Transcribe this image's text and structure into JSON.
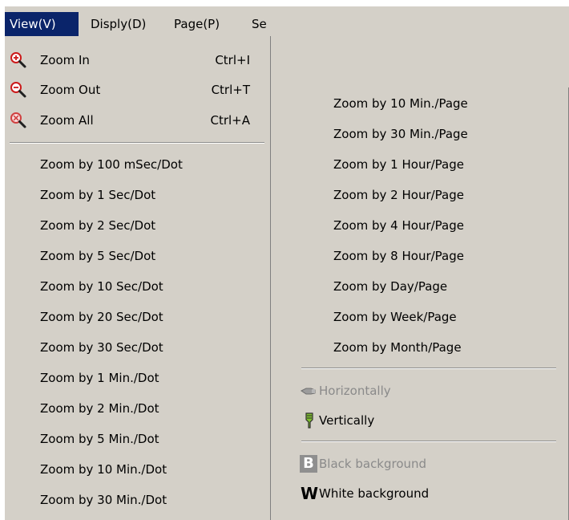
{
  "menubar": {
    "items": [
      {
        "label": "View(V)"
      },
      {
        "label": "Disply(D)"
      },
      {
        "label": "Page(P)"
      },
      {
        "label": "Se"
      }
    ]
  },
  "view_menu": {
    "items": [
      {
        "label": "Zoom In",
        "shortcut": "Ctrl+I",
        "icon": "zoom-in-icon"
      },
      {
        "label": "Zoom Out",
        "shortcut": "Ctrl+T",
        "icon": "zoom-out-icon"
      },
      {
        "label": "Zoom All",
        "shortcut": "Ctrl+A",
        "icon": "zoom-all-icon"
      },
      {
        "label": "Zoom by 100 mSec/Dot"
      },
      {
        "label": "Zoom by 1 Sec/Dot"
      },
      {
        "label": "Zoom by 2 Sec/Dot"
      },
      {
        "label": "Zoom by 5 Sec/Dot"
      },
      {
        "label": "Zoom by 10 Sec/Dot"
      },
      {
        "label": "Zoom by 20 Sec/Dot"
      },
      {
        "label": "Zoom by 30 Sec/Dot"
      },
      {
        "label": "Zoom by 1 Min./Dot"
      },
      {
        "label": "Zoom by 2 Min./Dot"
      },
      {
        "label": "Zoom by 5 Min./Dot"
      },
      {
        "label": "Zoom by 10 Min./Dot"
      },
      {
        "label": "Zoom by 30 Min./Dot"
      }
    ]
  },
  "continuation_menu": {
    "items": [
      {
        "label": "Zoom by 10 Min./Page"
      },
      {
        "label": "Zoom by 30 Min./Page"
      },
      {
        "label": "Zoom by 1 Hour/Page"
      },
      {
        "label": "Zoom by 2 Hour/Page"
      },
      {
        "label": "Zoom by 4 Hour/Page"
      },
      {
        "label": "Zoom by 8 Hour/Page"
      },
      {
        "label": "Zoom by Day/Page"
      },
      {
        "label": "Zoom by Week/Page"
      },
      {
        "label": "Zoom by Month/Page"
      },
      {
        "label": "Horizontally",
        "disabled": true,
        "icon": "horizontal-hand-icon"
      },
      {
        "label": "Vertically",
        "icon": "vertical-hand-icon"
      },
      {
        "label": "Black background",
        "disabled": true,
        "icon": "black-background-icon"
      },
      {
        "label": "White background",
        "icon": "white-background-icon"
      }
    ]
  },
  "icons": {
    "black_background_letter": "B",
    "white_background_letter": "W"
  },
  "colors": {
    "menu_bg": "#d4d0c8",
    "menubar_active_bg": "#0a246a",
    "menubar_active_fg": "#ffffff",
    "disabled_text": "#8a8a8a",
    "zoom_in_accent": "#cc1a1a",
    "zoom_out_accent": "#cc1a1a",
    "zoom_all_accent": "#d04040",
    "vertical_hand_fill": "#7fbf2f"
  }
}
